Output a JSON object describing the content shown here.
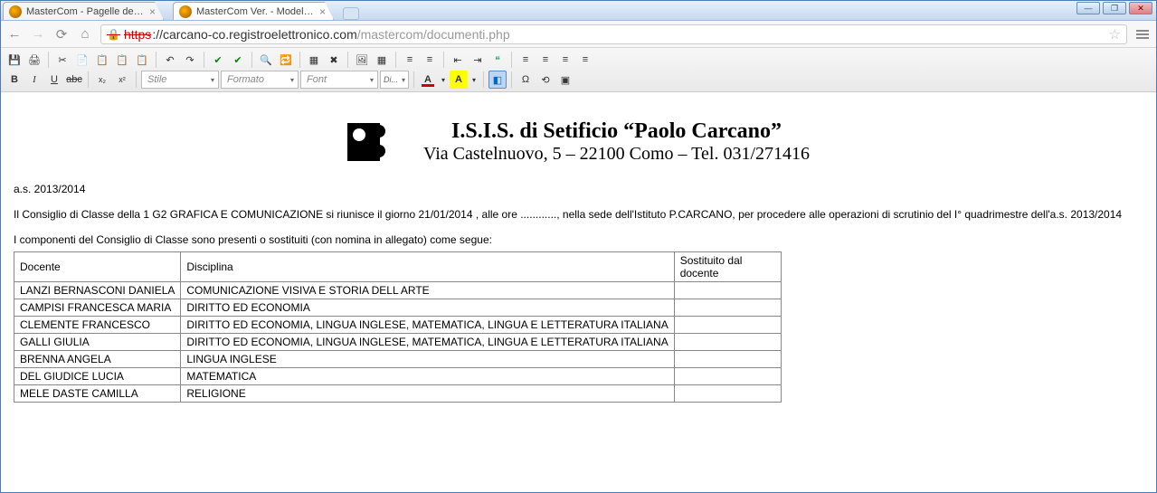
{
  "browser": {
    "tabs": [
      {
        "title": "MasterCom - Pagelle del Prof",
        "active": false
      },
      {
        "title": "MasterCom Ver. - Modello di",
        "active": true
      }
    ],
    "url_https": "https",
    "url_domain": "://carcano-co.registroelettronico.com",
    "url_path": "/mastercom/documenti.php"
  },
  "toolbar": {
    "combos": {
      "stile": "Stile",
      "formato": "Formato",
      "font": "Font",
      "dim": "Di..."
    }
  },
  "doc": {
    "letterhead": {
      "title": "I.S.I.S. di Setificio “Paolo Carcano”",
      "address": "Via Castelnuovo, 5 – 22100 Como – Tel. 031/271416"
    },
    "as": "a.s. 2013/2014",
    "para1": "Il Consiglio di Classe della 1 G2 GRAFICA E COMUNICAZIONE si riunisce il giorno 21/01/2014 , alle ore ............, nella sede dell'Istituto P.CARCANO, per procedere alle operazioni di scrutinio del I° quadrimestre dell'a.s. 2013/2014",
    "para2": "I componenti del Consiglio di Classe sono presenti o sostituiti  (con nomina in allegato) come segue:",
    "headers": {
      "docente": "Docente",
      "disciplina": "Disciplina",
      "sost": "Sostituito dal docente"
    },
    "rows": [
      {
        "docente": "LANZI BERNASCONI DANIELA",
        "disciplina": "COMUNICAZIONE VISIVA E STORIA DELL ARTE",
        "sost": ""
      },
      {
        "docente": "CAMPISI FRANCESCA MARIA",
        "disciplina": "DIRITTO ED ECONOMIA",
        "sost": ""
      },
      {
        "docente": "CLEMENTE FRANCESCO",
        "disciplina": "DIRITTO ED ECONOMIA, LINGUA INGLESE, MATEMATICA, LINGUA E LETTERATURA ITALIANA",
        "sost": ""
      },
      {
        "docente": "GALLI GIULIA",
        "disciplina": "DIRITTO ED ECONOMIA, LINGUA INGLESE, MATEMATICA, LINGUA E LETTERATURA ITALIANA",
        "sost": ""
      },
      {
        "docente": "BRENNA ANGELA",
        "disciplina": "LINGUA INGLESE",
        "sost": ""
      },
      {
        "docente": "DEL GIUDICE LUCIA",
        "disciplina": "MATEMATICA",
        "sost": ""
      },
      {
        "docente": "MELE DASTE CAMILLA",
        "disciplina": "RELIGIONE",
        "sost": ""
      }
    ]
  }
}
